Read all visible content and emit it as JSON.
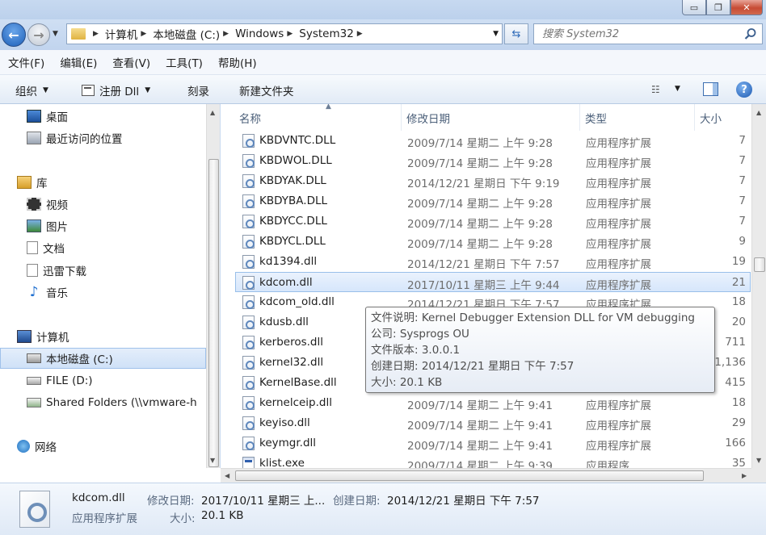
{
  "window": {
    "min": "▭",
    "max": "❐",
    "close": "✕"
  },
  "address": {
    "crumbs": [
      "计算机",
      "本地磁盘 (C:)",
      "Windows",
      "System32"
    ],
    "search_placeholder": "搜索 System32"
  },
  "menu": [
    "文件(F)",
    "编辑(E)",
    "查看(V)",
    "工具(T)",
    "帮助(H)"
  ],
  "commands": {
    "organize": "组织",
    "register": "注册 Dll",
    "burn": "刻录",
    "new_folder": "新建文件夹"
  },
  "nav": {
    "desktop": "桌面",
    "recent": "最近访问的位置",
    "libraries": "库",
    "videos": "视频",
    "pictures": "图片",
    "documents": "文档",
    "thunder": "迅雷下载",
    "music": "音乐",
    "computer": "计算机",
    "local_disk": "本地磁盘 (C:)",
    "file_d": "FILE (D:)",
    "shared": "Shared Folders (\\\\vmware-h",
    "network": "网络"
  },
  "columns": {
    "name": "名称",
    "date": "修改日期",
    "type": "类型",
    "size": "大小"
  },
  "files": [
    {
      "name": "KBDVNTC.DLL",
      "date": "2009/7/14 星期二 上午 9:28",
      "type": "应用程序扩展",
      "size": "7"
    },
    {
      "name": "KBDWOL.DLL",
      "date": "2009/7/14 星期二 上午 9:28",
      "type": "应用程序扩展",
      "size": "7"
    },
    {
      "name": "KBDYAK.DLL",
      "date": "2014/12/21 星期日 下午 9:19",
      "type": "应用程序扩展",
      "size": "7"
    },
    {
      "name": "KBDYBA.DLL",
      "date": "2009/7/14 星期二 上午 9:28",
      "type": "应用程序扩展",
      "size": "7"
    },
    {
      "name": "KBDYCC.DLL",
      "date": "2009/7/14 星期二 上午 9:28",
      "type": "应用程序扩展",
      "size": "7"
    },
    {
      "name": "KBDYCL.DLL",
      "date": "2009/7/14 星期二 上午 9:28",
      "type": "应用程序扩展",
      "size": "9"
    },
    {
      "name": "kd1394.dll",
      "date": "2014/12/21 星期日 下午 7:57",
      "type": "应用程序扩展",
      "size": "19"
    },
    {
      "name": "kdcom.dll",
      "date": "2017/10/11 星期三 上午 9:44",
      "type": "应用程序扩展",
      "size": "21"
    },
    {
      "name": "kdcom_old.dll",
      "date": "2014/12/21 星期日 下午 7:57",
      "type": "应用程序扩展",
      "size": "18"
    },
    {
      "name": "kdusb.dll",
      "date": "",
      "type": "",
      "size": "20"
    },
    {
      "name": "kerberos.dll",
      "date": "",
      "type": "",
      "size": "711"
    },
    {
      "name": "kernel32.dll",
      "date": "",
      "type": "",
      "size": "1,136"
    },
    {
      "name": "KernelBase.dll",
      "date": "",
      "type": "",
      "size": "415"
    },
    {
      "name": "kernelceip.dll",
      "date": "2009/7/14 星期二 上午 9:41",
      "type": "应用程序扩展",
      "size": "18"
    },
    {
      "name": "keyiso.dll",
      "date": "2009/7/14 星期二 上午 9:41",
      "type": "应用程序扩展",
      "size": "29"
    },
    {
      "name": "keymgr.dll",
      "date": "2009/7/14 星期二 上午 9:41",
      "type": "应用程序扩展",
      "size": "166"
    },
    {
      "name": "klist.exe",
      "date": "2009/7/14 星期二 上午 9:39",
      "type": "应用程序",
      "size": "35"
    }
  ],
  "tooltip": {
    "desc": "文件说明: Kernel Debugger Extension DLL for VM debugging",
    "company": "公司: Sysprogs OU",
    "version": "文件版本: 3.0.0.1",
    "created": "创建日期: 2014/12/21 星期日 下午 7:57",
    "size": "大小: 20.1 KB"
  },
  "details": {
    "filename": "kdcom.dll",
    "modified_label": "修改日期:",
    "modified_value": "2017/10/11 星期三 上...",
    "created_label": "创建日期:",
    "created_value": "2014/12/21 星期日 下午 7:57",
    "type": "应用程序扩展",
    "size_label": "大小:",
    "size_value": "20.1 KB"
  },
  "colors": {
    "selection": "#d6e6fb",
    "accent": "#1d5fb8"
  }
}
